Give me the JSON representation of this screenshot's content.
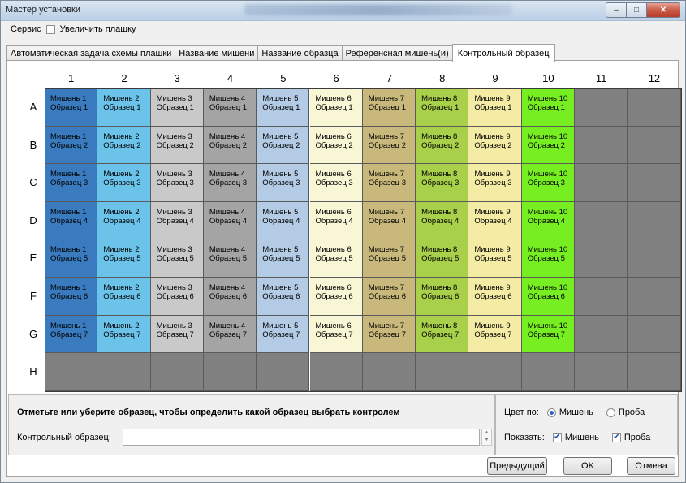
{
  "window": {
    "title": "Мастер установки"
  },
  "menu": {
    "service": "Сервис",
    "enlarge_label": "Увеличить плашку",
    "enlarge_checked": false
  },
  "tabs": [
    {
      "label": "Автоматическая задача схемы плашки",
      "active": false
    },
    {
      "label": "Название мишени",
      "active": false
    },
    {
      "label": "Название образца",
      "active": false
    },
    {
      "label": "Референсная мишень(и)",
      "active": false
    },
    {
      "label": "Контрольный образец",
      "active": true
    }
  ],
  "plate": {
    "columns": [
      "1",
      "2",
      "3",
      "4",
      "5",
      "6",
      "7",
      "8",
      "9",
      "10",
      "11",
      "12"
    ],
    "rows": [
      "A",
      "B",
      "C",
      "D",
      "E",
      "F",
      "G",
      "H"
    ],
    "target_prefix": "Мишень",
    "sample_prefix": "Образец",
    "empty_color": "#808080",
    "target_colors": [
      "#3a7bbf",
      "#6cc3ea",
      "#c9c9c9",
      "#a4a4a4",
      "#b4cbe6",
      "#f9f6d5",
      "#c9b87c",
      "#a9d04a",
      "#f4eca4",
      "#77ee22"
    ],
    "filled_columns": 10,
    "filled_rows": 7
  },
  "bottom": {
    "instruction": "Отметьте или уберите образец, чтобы определить какой образец выбрать контролем",
    "control_sample_label": "Контрольный образец:",
    "control_sample_value": "",
    "color_by_label": "Цвет по:",
    "color_target": "Мишень",
    "color_sample": "Проба",
    "color_by_selected": "target",
    "show_label": "Показать:",
    "show_target": "Мишень",
    "show_sample": "Проба",
    "show_target_checked": true,
    "show_sample_checked": true
  },
  "buttons": {
    "prev": "Предыдущий",
    "ok": "OK",
    "cancel": "Отмена"
  }
}
